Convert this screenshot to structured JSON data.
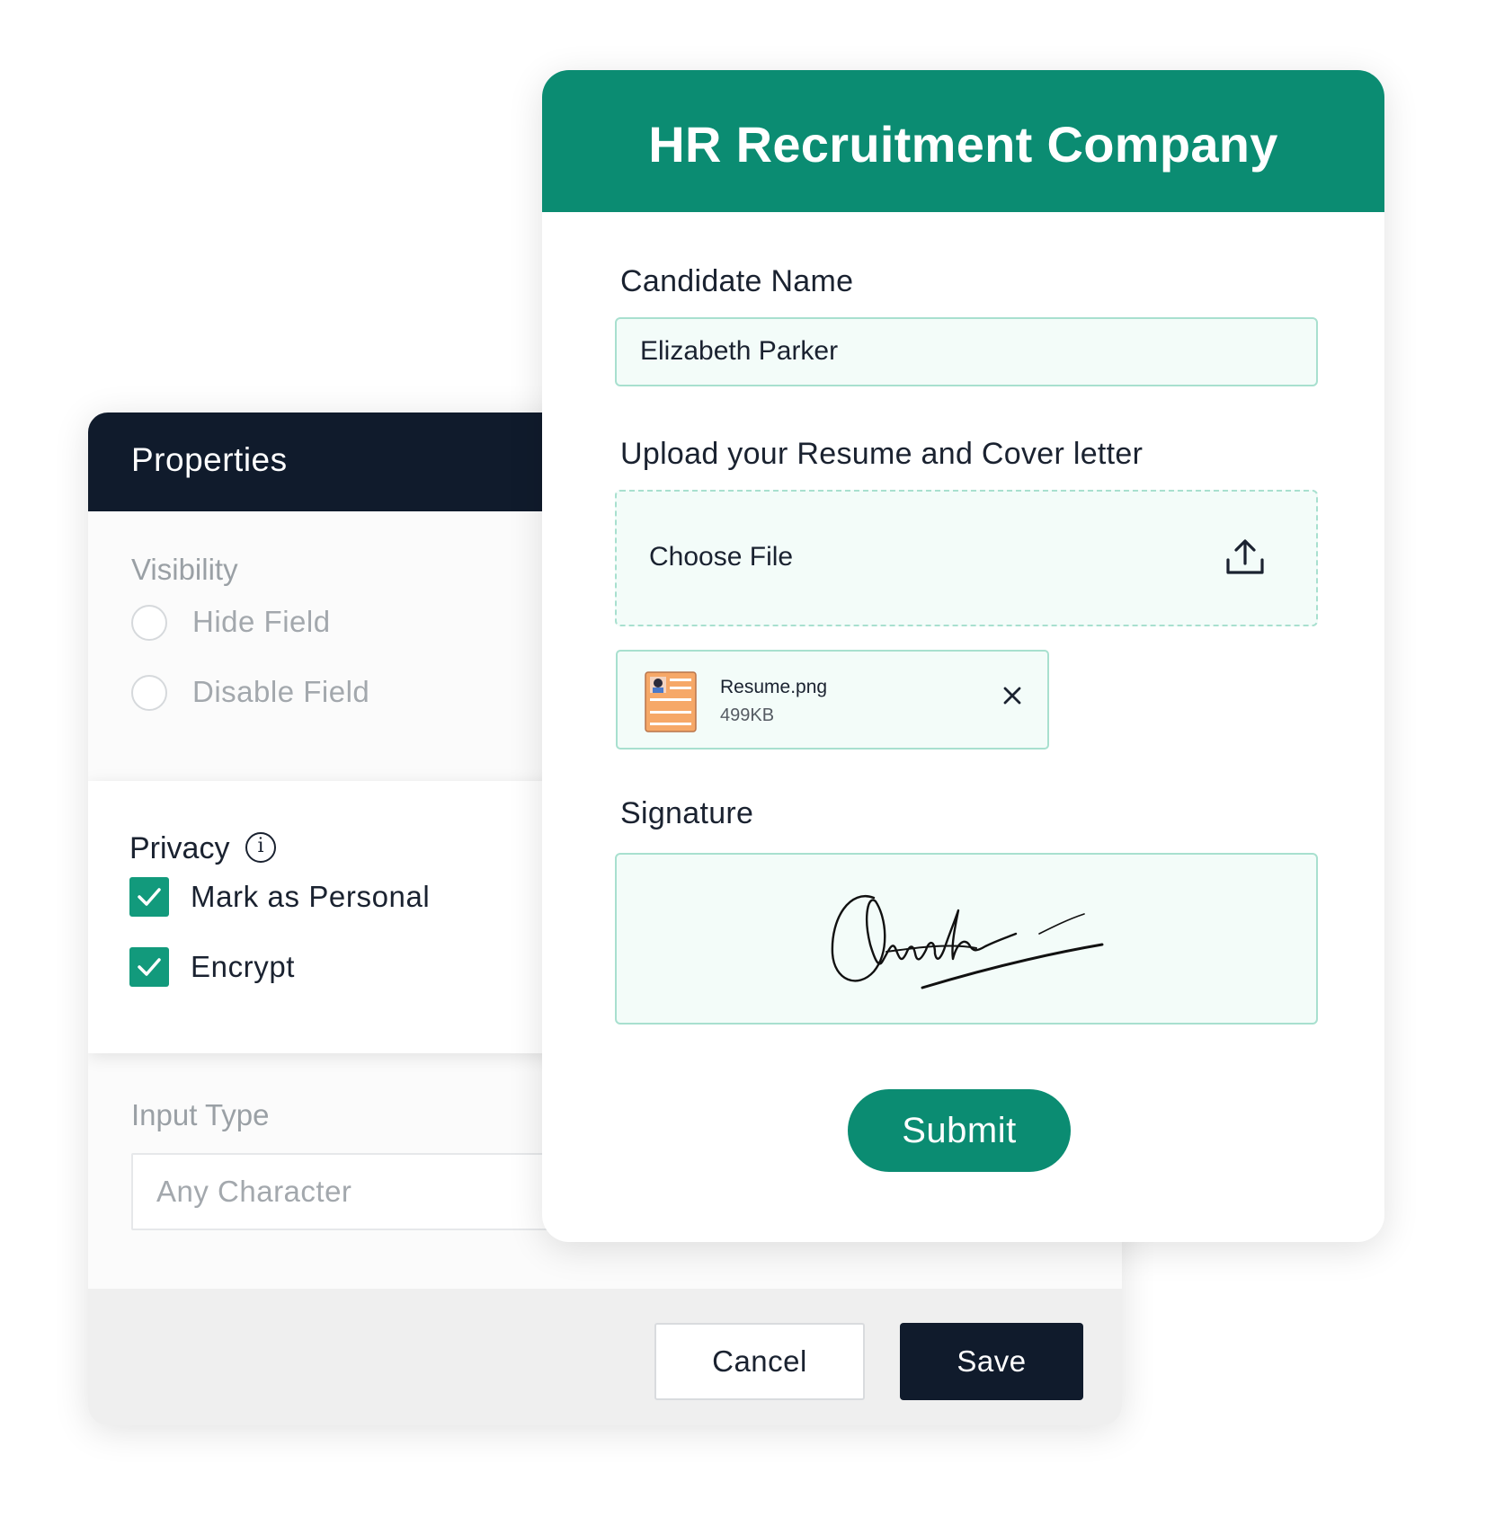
{
  "properties": {
    "title": "Properties",
    "visibility": {
      "label": "Visibility",
      "options": [
        "Hide Field",
        "Disable Field"
      ]
    },
    "privacy": {
      "label": "Privacy",
      "info_icon": "info-icon",
      "options": [
        {
          "label": "Mark as Personal",
          "checked": true
        },
        {
          "label": "Encrypt",
          "checked": true
        }
      ]
    },
    "input_type": {
      "label": "Input Type",
      "value": "Any Character"
    },
    "footer": {
      "cancel_label": "Cancel",
      "save_label": "Save"
    }
  },
  "form": {
    "title": "HR Recruitment Company",
    "candidate_name": {
      "label": "Candidate Name",
      "value": "Elizabeth Parker"
    },
    "upload": {
      "label": "Upload your Resume and Cover letter",
      "choose_label": "Choose File",
      "icon": "upload-icon",
      "file": {
        "name": "Resume.png",
        "size": "499KB",
        "icon": "document-thumbnail-icon",
        "remove_icon": "close-icon"
      }
    },
    "signature": {
      "label": "Signature"
    },
    "submit_label": "Submit"
  },
  "colors": {
    "brand_green": "#0b8c72",
    "checkbox_green": "#129a7c",
    "navy": "#101b2c",
    "field_bg": "#f3fcf9",
    "field_border": "#a8e0cf"
  }
}
